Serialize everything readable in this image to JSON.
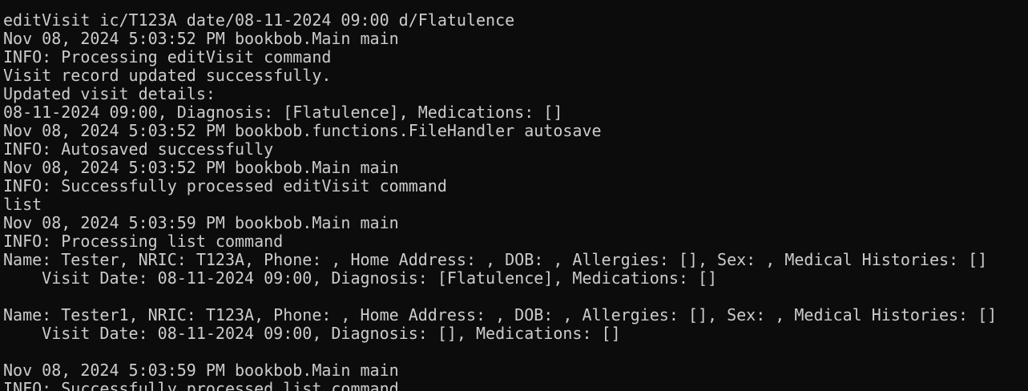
{
  "terminal": {
    "lines": [
      "",
      "editVisit ic/T123A date/08-11-2024 09:00 d/Flatulence",
      "Nov 08, 2024 5:03:52 PM bookbob.Main main",
      "INFO: Processing editVisit command",
      "Visit record updated successfully.",
      "Updated visit details:",
      "08-11-2024 09:00, Diagnosis: [Flatulence], Medications: []",
      "Nov 08, 2024 5:03:52 PM bookbob.functions.FileHandler autosave",
      "INFO: Autosaved successfully",
      "Nov 08, 2024 5:03:52 PM bookbob.Main main",
      "INFO: Successfully processed editVisit command",
      "list",
      "Nov 08, 2024 5:03:59 PM bookbob.Main main",
      "INFO: Processing list command",
      "Name: Tester, NRIC: T123A, Phone: , Home Address: , DOB: , Allergies: [], Sex: , Medical Histories: []",
      "    Visit Date: 08-11-2024 09:00, Diagnosis: [Flatulence], Medications: []",
      "",
      "Name: Tester1, NRIC: T123A, Phone: , Home Address: , DOB: , Allergies: [], Sex: , Medical Histories: []",
      "    Visit Date: 08-11-2024 09:00, Diagnosis: [], Medications: []",
      "",
      "Nov 08, 2024 5:03:59 PM bookbob.Main main",
      "INFO: Successfully processed list command"
    ]
  }
}
